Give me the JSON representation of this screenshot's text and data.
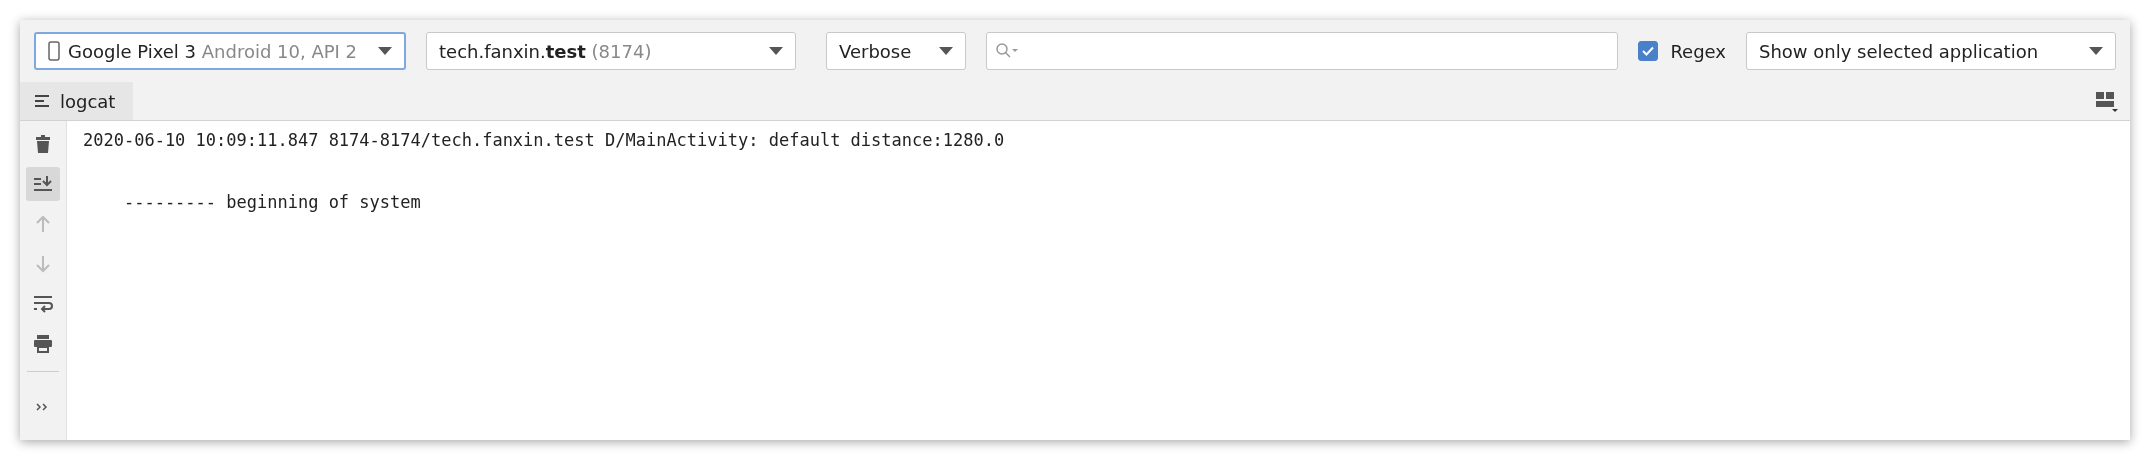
{
  "toolbar": {
    "device": {
      "name": "Google Pixel 3",
      "detail": "Android 10, API 2",
      "focused": true
    },
    "process": {
      "name": "tech.fanxin.**test**",
      "pid": "(8174)"
    },
    "log_level": {
      "value": "Verbose"
    },
    "regex": {
      "label": "Regex",
      "checked": true
    },
    "filter": {
      "value": "Show only selected application"
    }
  },
  "tabs": [
    {
      "label": "logcat",
      "selected": true
    }
  ],
  "side_tools": [
    {
      "kind": "clear",
      "active": false,
      "disabled": false
    },
    {
      "kind": "scroll_end",
      "active": true,
      "disabled": false
    },
    {
      "kind": "up",
      "active": false,
      "disabled": true
    },
    {
      "kind": "down",
      "active": false,
      "disabled": true
    },
    {
      "kind": "wrap",
      "active": false,
      "disabled": false
    },
    {
      "kind": "print",
      "active": false,
      "disabled": false
    },
    {
      "kind": "more",
      "active": false,
      "disabled": false
    }
  ],
  "log_lines": [
    {
      "kind": "message",
      "text": "2020-06-10 10:09:11.847 8174-8174/tech.fanxin.test D/MainActivity: default distance:1280.0"
    },
    {
      "kind": "banner",
      "text": "    --------- beginning of system"
    }
  ]
}
